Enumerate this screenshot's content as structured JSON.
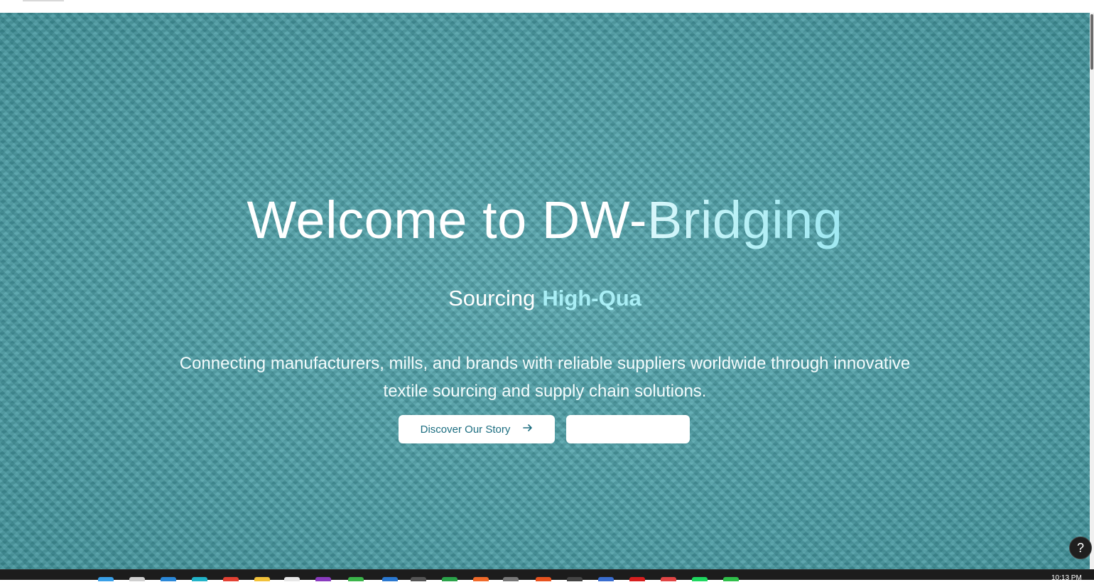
{
  "hero": {
    "title_main": "Welcome to DW-",
    "title_accent": "Bridging",
    "subtitle_lead": "Sourcing",
    "subtitle_typed": "High-Qua",
    "description": "Connecting manufacturers, mills, and brands with reliable suppliers worldwide through innovative textile sourcing and supply chain solutions.",
    "primary_button_label": "Discover Our Story",
    "secondary_button_label": ""
  },
  "help": {
    "label": "?"
  },
  "taskbar": {
    "clock": "10:13 PM",
    "icons": [
      {
        "name": "windows-start-icon",
        "color": "#3aa0e8"
      },
      {
        "name": "search-icon",
        "color": "#d0d0d0"
      },
      {
        "name": "vscode-icon",
        "color": "#2b88d8"
      },
      {
        "name": "edge-icon",
        "color": "#21b3c8"
      },
      {
        "name": "chrome-icon",
        "color": "#e34133"
      },
      {
        "name": "file-explorer-icon",
        "color": "#f2c23a"
      },
      {
        "name": "calendar-app-icon",
        "color": "#e8e8e8"
      },
      {
        "name": "onenote-icon",
        "color": "#8a3bbf"
      },
      {
        "name": "store-icon",
        "color": "#3bb54a"
      },
      {
        "name": "photos-icon",
        "color": "#2a78d0"
      },
      {
        "name": "app-icon-dark",
        "color": "#555555"
      },
      {
        "name": "xbox-icon",
        "color": "#2aa34a"
      },
      {
        "name": "brave-icon",
        "color": "#f06a2a"
      },
      {
        "name": "app-icon-gray",
        "color": "#777777"
      },
      {
        "name": "office-icon",
        "color": "#e8531f"
      },
      {
        "name": "terminal-icon",
        "color": "#444444"
      },
      {
        "name": "remote-desktop-icon",
        "color": "#3a6ed0"
      },
      {
        "name": "pdf-icon",
        "color": "#d81f1f"
      },
      {
        "name": "mail-icon",
        "color": "#e04545"
      },
      {
        "name": "spotify-icon",
        "color": "#1ed760"
      },
      {
        "name": "check-icon",
        "color": "#2fbf4a"
      }
    ]
  }
}
